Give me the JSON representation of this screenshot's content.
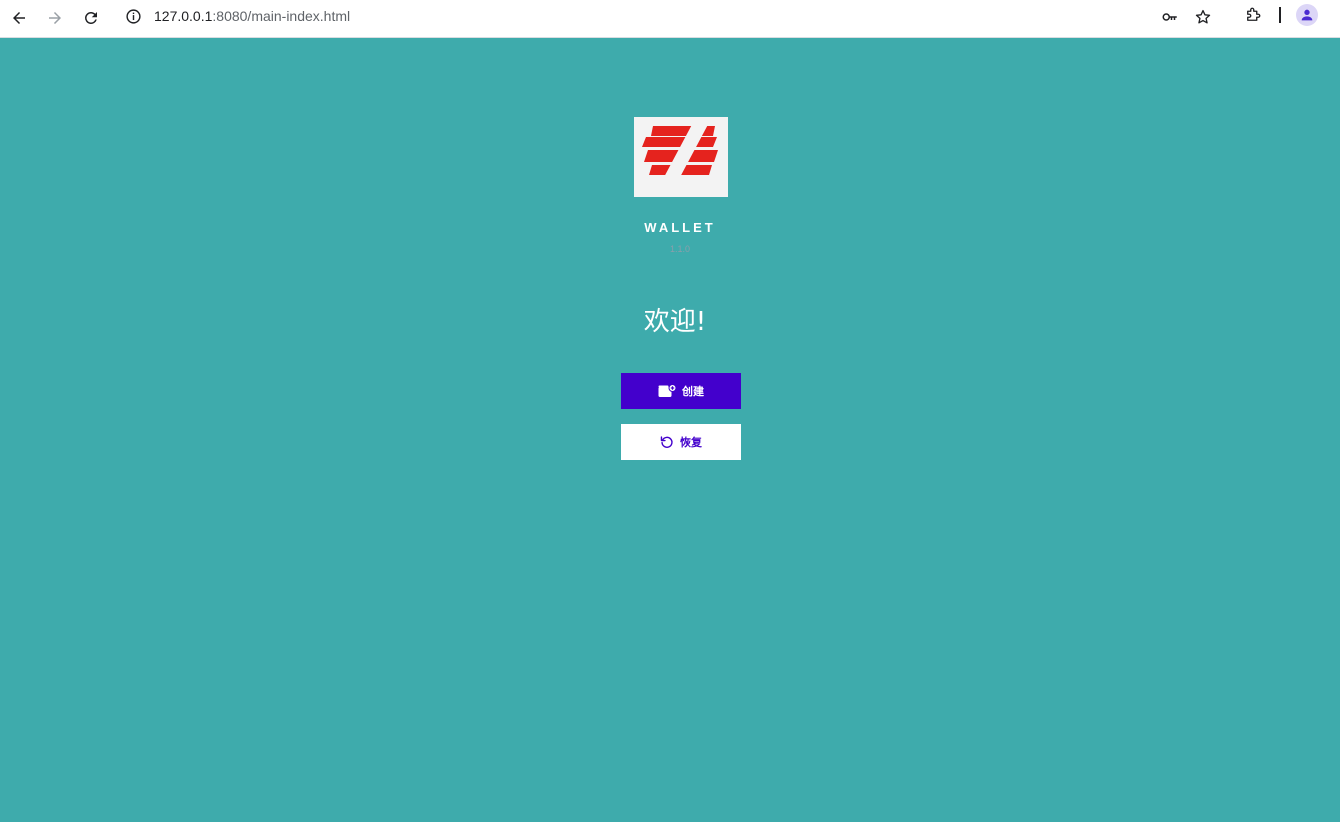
{
  "browser": {
    "url_host": "127.0.0.1",
    "url_rest": ":8080/main-index.html"
  },
  "brand": {
    "title": "WALLET",
    "subtitle": "1.1.0"
  },
  "welcome": "欢迎!",
  "actions": {
    "create_label": "创建",
    "restore_label": "恢复"
  },
  "colors": {
    "background": "#3eabac",
    "primary": "#4300cc",
    "logo_red": "#e5231e"
  },
  "icons": {
    "create": "wallet-add-icon",
    "restore": "restore-icon"
  }
}
